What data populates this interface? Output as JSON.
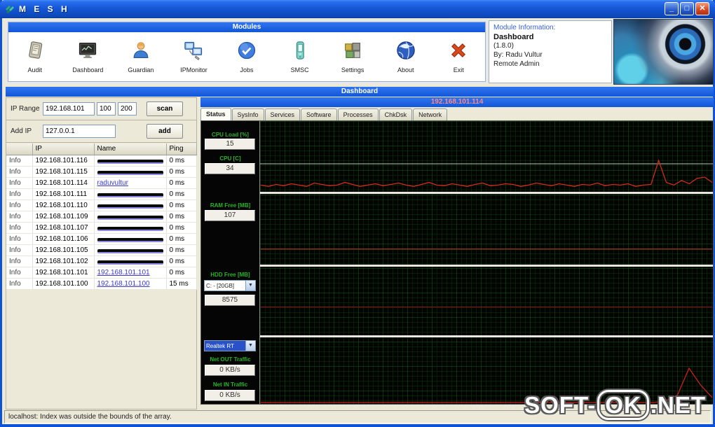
{
  "window": {
    "title": "M E S H",
    "controls": {
      "minimize": "_",
      "maximize": "□",
      "close": "✕"
    },
    "status_bar": "localhost: Index was outside the bounds of the array."
  },
  "modules_panel": {
    "header": "Modules",
    "items": [
      {
        "label": "Audit",
        "icon": "audit-icon"
      },
      {
        "label": "Dashboard",
        "icon": "dashboard-icon"
      },
      {
        "label": "Guardian",
        "icon": "guardian-icon"
      },
      {
        "label": "IPMonitor",
        "icon": "ipmonitor-icon"
      },
      {
        "label": "Jobs",
        "icon": "jobs-icon"
      },
      {
        "label": "SMSC",
        "icon": "smsc-icon"
      },
      {
        "label": "Settings",
        "icon": "settings-icon"
      },
      {
        "label": "About",
        "icon": "about-icon"
      },
      {
        "label": "Exit",
        "icon": "exit-icon"
      }
    ]
  },
  "module_info": {
    "header": "Module Information:",
    "name": "Dashboard",
    "version": "(1.8.0)",
    "author": "By: Radu Vultur",
    "type": "Remote Admin"
  },
  "dashboard": {
    "header": "Dashboard",
    "ip_header": "192.168.101.114",
    "tabs": [
      "Status",
      "SysInfo",
      "Services",
      "Software",
      "Processes",
      "ChkDsk",
      "Network"
    ],
    "active_tab": "Status"
  },
  "scanner": {
    "ip_range_label": "IP Range",
    "ip_base": "192.168.101",
    "range_from": "100",
    "range_to": "200",
    "scan_label": "scan",
    "add_ip_label": "Add IP",
    "add_ip_value": "127.0.0.1",
    "add_label": "add"
  },
  "host_list": {
    "columns": [
      "",
      "IP",
      "Name",
      "Ping"
    ],
    "rows": [
      {
        "info": "Info",
        "ip": "192.168.101.116",
        "name": "",
        "redacted": true,
        "ping": "0 ms"
      },
      {
        "info": "Info",
        "ip": "192.168.101.115",
        "name": "",
        "redacted": true,
        "ping": "0 ms"
      },
      {
        "info": "Info",
        "ip": "192.168.101.114",
        "name": "raduvultur",
        "redacted": false,
        "ping": "0 ms"
      },
      {
        "info": "Info",
        "ip": "192.168.101.111",
        "name": "",
        "redacted": true,
        "ping": "0 ms"
      },
      {
        "info": "Info",
        "ip": "192.168.101.110",
        "name": "",
        "redacted": true,
        "ping": "0 ms"
      },
      {
        "info": "Info",
        "ip": "192.168.101.109",
        "name": "",
        "redacted": true,
        "ping": "0 ms"
      },
      {
        "info": "Info",
        "ip": "192.168.101.107",
        "name": "",
        "redacted": true,
        "ping": "0 ms"
      },
      {
        "info": "Info",
        "ip": "192.168.101.106",
        "name": "",
        "redacted": true,
        "ping": "0 ms"
      },
      {
        "info": "Info",
        "ip": "192.168.101.105",
        "name": "",
        "redacted": true,
        "ping": "0 ms"
      },
      {
        "info": "Info",
        "ip": "192.168.101.102",
        "name": "",
        "redacted": true,
        "ping": "0 ms"
      },
      {
        "info": "Info",
        "ip": "192.168.101.101",
        "name": "192.168.101.101",
        "redacted": false,
        "ping": "0 ms"
      },
      {
        "info": "Info",
        "ip": "192.168.101.100",
        "name": "192.168.101.100",
        "redacted": false,
        "ping": "15 ms"
      }
    ]
  },
  "status_readouts": {
    "cpu_load": {
      "label": "CPU Load [%]",
      "value": "15"
    },
    "cpu_temp": {
      "label": "CPU [C]",
      "value": "34"
    },
    "ram_free": {
      "label": "RAM Free [MB]",
      "value": "107"
    },
    "hdd_free": {
      "label": "HDD Free [MB]",
      "drive": "C: - [20GB]",
      "value": "8575"
    },
    "adapter": {
      "value": "Realtek RT"
    },
    "net_out": {
      "label": "Net OUT Traffic",
      "value": "0 KB/s"
    },
    "net_in": {
      "label": "Net IN Traffic",
      "value": "0 KB/s"
    }
  },
  "colors": {
    "grid_minor": "#0d380d",
    "grid_major": "#176017",
    "separator": "#e8e8e0",
    "label_green": "#27b527",
    "titlebar_blue": "#1557d6"
  },
  "chart_data": [
    {
      "type": "line",
      "name": "cpu-load-history",
      "ylabel": "CPU Load %",
      "ylim": [
        0,
        100
      ],
      "color": "#d42a1a",
      "marker_line": 40,
      "marker_color": "#b9c4b9",
      "values": [
        8,
        6,
        9,
        7,
        10,
        8,
        6,
        11,
        9,
        7,
        8,
        12,
        9,
        6,
        8,
        10,
        7,
        9,
        11,
        8,
        6,
        9,
        12,
        8,
        7,
        10,
        8,
        6,
        9,
        11,
        7,
        8,
        10,
        9,
        6,
        8,
        11,
        9,
        7,
        10,
        8,
        6,
        9,
        8,
        11,
        7,
        9,
        8,
        10,
        6,
        8,
        9,
        45,
        12,
        8,
        15,
        10,
        18,
        20,
        12
      ]
    },
    {
      "type": "line",
      "name": "cpu-temp-history",
      "ylabel": "CPU Temp C",
      "ylim": [
        0,
        160
      ],
      "color": "#8a3a20",
      "values": [
        34,
        34
      ]
    },
    {
      "type": "line",
      "name": "ram-free-history",
      "ylabel": "RAM Free MB",
      "ylim": [
        0,
        256
      ],
      "color": "#7a1515",
      "values": [
        107,
        107
      ]
    },
    {
      "type": "line",
      "name": "net-traffic-history",
      "ylabel": "Net Traffic KB/s",
      "ylim": [
        0,
        100
      ],
      "color": "#cc2018",
      "values": [
        0,
        0,
        0,
        0,
        0,
        0,
        0,
        0,
        0,
        0,
        0,
        0,
        0,
        0,
        0,
        0,
        0,
        0,
        0,
        0,
        0,
        0,
        0,
        0,
        0,
        0,
        0,
        0,
        0,
        0,
        0,
        0,
        0,
        0,
        0,
        3,
        12,
        55,
        28,
        8
      ]
    }
  ],
  "watermark": {
    "prefix": "SOFT-",
    "ok": "OK",
    "suffix": ".NET"
  }
}
